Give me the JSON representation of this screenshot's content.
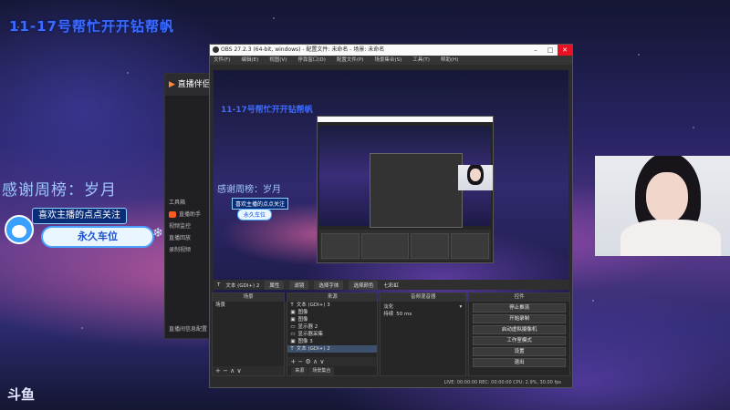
{
  "overlay": {
    "title": "11-17号帮忙开开钻帮帆",
    "thanks": "感谢周榜：岁月",
    "follow_top": "喜欢主播的点点关注",
    "follow_bottom": "永久车位",
    "corner_logo": "斗鱼"
  },
  "helper_app": {
    "title": "直播伴侣",
    "items": [
      "工具箱",
      "直播助手",
      "视频监控",
      "直播回放",
      "录制视频"
    ],
    "footer": "直播间信息配置"
  },
  "obs": {
    "window_title": "OBS 27.2.3 (64-bit, windows) - 配置文件: 未命名 - 场景: 未命名",
    "window_buttons": [
      "–",
      "□",
      "✕"
    ],
    "menu": [
      "文件(F)",
      "编辑(E)",
      "视图(V)",
      "停靠窗口(D)",
      "配置文件(P)",
      "场景集合(S)",
      "工具(T)",
      "帮助(H)"
    ],
    "preview_text": {
      "title": "11-17号帮忙开开钻帮帆",
      "thanks": "感谢周榜：岁月",
      "follow_top": "喜欢主播的点点关注",
      "follow_bottom": "永久车位"
    },
    "source_toolbar": {
      "label": "文本 (GDI+) 2",
      "buttons": [
        "属性",
        "滤镜",
        "选择字体",
        "选择颜色"
      ],
      "text_value": "七彩虹"
    },
    "docks": {
      "scenes": {
        "header": "场景",
        "items": [
          "场景"
        ],
        "footer": "+ − ∧ ∨"
      },
      "sources": {
        "header": "来源",
        "items": [
          "文本 (GDI+) 3",
          "图像",
          "图像",
          "显示器 2",
          "显示器采集",
          "图像 3",
          "文本 (GDI+) 2"
        ],
        "tabs": [
          "来源",
          "场景集合"
        ],
        "footer": "+ − ⚙ ∧ ∨"
      },
      "mixer": {
        "header": "音频混音器",
        "row1_label": "淡化",
        "row2_label": "持续",
        "row2_value": "50 ms"
      },
      "controls": {
        "header": "控件",
        "buttons": [
          "停止推流",
          "开始录制",
          "启动虚拟摄像机",
          "工作室模式",
          "设置",
          "退出"
        ]
      }
    },
    "statusbar": "LIVE: 00:00:00   REC: 00:00:00   CPU: 2.9%, 30.00 fps"
  }
}
